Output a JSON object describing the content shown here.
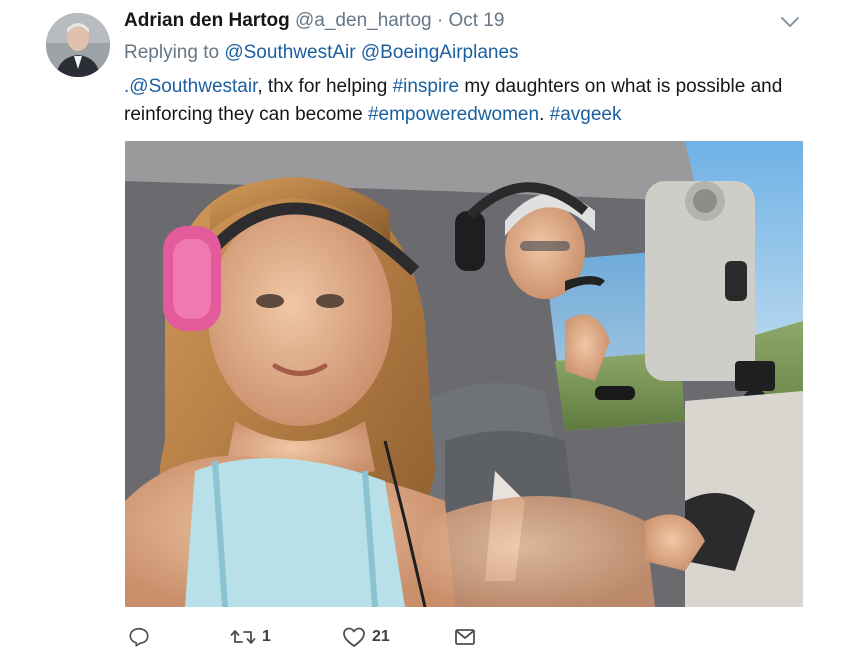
{
  "tweet": {
    "author_name": "Adrian den Hartog",
    "handle": "@a_den_hartog",
    "separator": "·",
    "date": "Oct 19",
    "replying_label": "Replying to",
    "reply_mentions": [
      "@SouthwestAir",
      "@BoeingAirplanes"
    ],
    "text_segments": [
      {
        "type": "mention",
        "text": ".@Southwestair"
      },
      {
        "type": "text",
        "text": ", thx for helping "
      },
      {
        "type": "hashtag",
        "text": "#inspire"
      },
      {
        "type": "text",
        "text": " my daughters on what is possible and reinforcing they can become "
      },
      {
        "type": "hashtag",
        "text": "#empoweredwomen"
      },
      {
        "type": "text",
        "text": ". "
      },
      {
        "type": "hashtag",
        "text": "#avgeek"
      }
    ]
  },
  "actions": {
    "reply_icon": "reply-icon",
    "retweet_icon": "retweet-icon",
    "retweet_count": "1",
    "like_icon": "heart-icon",
    "like_count": "21",
    "dm_icon": "envelope-icon"
  },
  "colors": {
    "link": "#1b5fa0",
    "secondary_text": "#657786",
    "primary_text": "#14171a"
  }
}
